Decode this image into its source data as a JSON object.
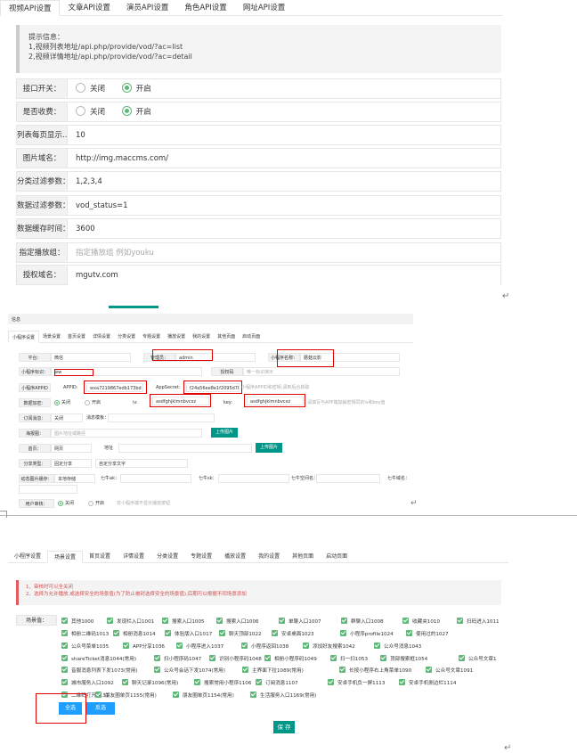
{
  "panel1": {
    "tabs": [
      {
        "label": "视频API设置",
        "active": true
      },
      {
        "label": "文章API设置"
      },
      {
        "label": "演员API设置"
      },
      {
        "label": "角色API设置"
      },
      {
        "label": "网址API设置"
      }
    ],
    "tip": {
      "title": "提示信息：",
      "line1": "1,视频列表地址/api.php/provide/vod/?ac=list",
      "line2": "2,视频详情地址/api.php/provide/vod/?ac=detail"
    },
    "api_switch": {
      "label": "接口开关：",
      "off": "关闭",
      "on": "开启"
    },
    "charge": {
      "label": "是否收费：",
      "off": "关闭",
      "on": "开启"
    },
    "page_size": {
      "label": "列表每页显示...",
      "value": "10"
    },
    "pic_domain": {
      "label": "图片域名：",
      "value": "http://img.maccms.com/"
    },
    "type_filter": {
      "label": "分类过滤参数：",
      "value": "1,2,3,4"
    },
    "data_filter": {
      "label": "数据过滤参数：",
      "value": "vod_status=1"
    },
    "cache_time": {
      "label": "数据缓存时间：",
      "value": "3600"
    },
    "play_group": {
      "label": "指定播放组：",
      "placeholder": "指定播放组 例如youku"
    },
    "auth_domain": {
      "label": "授权域名：",
      "value": "mgutv.com"
    },
    "return_mark": "↵"
  },
  "panel2": {
    "title": "信息",
    "tabs": [
      "小程序设置",
      "场景设置",
      "首页设置",
      "详情设置",
      "分类设置",
      "专题设置",
      "播放设置",
      "我的设置",
      "其他页面",
      "启动页面"
    ],
    "platform": {
      "label": "平台：",
      "value": "微信"
    },
    "admin": {
      "label": "管理员：",
      "value": "admin"
    },
    "mp_name": {
      "label": "小程序名称：",
      "value": "蘑菇云影"
    },
    "mp_id": {
      "label": "小程序标识：",
      "value": "ww"
    },
    "auth_code": {
      "label": "授权码",
      "placeholder": "唯一标识演示"
    },
    "mp_appid": {
      "label": "小程序APPID",
      "appid_label": "APPID:",
      "appid": "wxa7219867edb173bd",
      "secret_label": "AppSecret:",
      "secret": "f24a56ee8e1f2095d7b459f",
      "hint": "小程序APPID和密钥,请到后台获取"
    },
    "data_encrypt": {
      "label": "数据加密：",
      "off": "关闭",
      "on": "开启",
      "iv_label": "iv:",
      "iv": "asdfghjklmnbvcxz",
      "key_label": "key:",
      "key": "asdfghjklmnbvcxz",
      "hint": "请填写与APP端加解密相同的iv和key值"
    },
    "sub_msg": {
      "label": "订阅消息：",
      "value": "关闭",
      "tpl_label": "消息模板："
    },
    "share_img": {
      "label": "海报图：",
      "placeholder": "图片地址或路径",
      "upload": "上传图片"
    },
    "home": {
      "label": "首页：",
      "value": "网页",
      "addr_label": "地址"
    },
    "upload2": "上传图片",
    "share_type": {
      "label": "分享类型：",
      "value": "固定分享",
      "text": "自定分享文字"
    },
    "dyn_img": {
      "label": "动态图片缓存：",
      "value": "本地存储",
      "seven_ak": "七牛ak：",
      "seven_sk": "七牛sk：",
      "seven_space": "七牛空间名：",
      "seven_domain": "七牛域名："
    },
    "user_review": {
      "label": "用户审核：",
      "off": "关闭",
      "on": "开启",
      "hint": "非小程序端不显示播放按钮"
    },
    "return_mark": "↵"
  },
  "panel3": {
    "tabs": [
      {
        "label": "小程序设置"
      },
      {
        "label": "场景设置",
        "active": true
      },
      {
        "label": "首页设置"
      },
      {
        "label": "详情设置"
      },
      {
        "label": "分类设置"
      },
      {
        "label": "专题设置"
      },
      {
        "label": "播放设置"
      },
      {
        "label": "我的设置"
      },
      {
        "label": "其他页面"
      },
      {
        "label": "启动页面"
      }
    ],
    "tip": {
      "line1": "1、审核时可以全关闭",
      "line2": "2、选择为允许播放,或选择安全的场景值(为了防止被封选择安全的场景值),后期可以根据不同场景添加"
    },
    "scene_label": "场景值：",
    "scenes": [
      [
        "其他1000",
        "发现栏入口1001",
        "搜索入口1005",
        "搜索入口1006",
        "单聊入口1007",
        "群聊入口1008",
        "收藏夹1010",
        "扫码进入1011"
      ],
      [
        "相册二维码1013",
        "相册消息1014",
        "体验版入口1017",
        "聊天顶部1022",
        "安卓桌面1023",
        "小程序profile1024",
        "使用过的1027"
      ],
      [
        "公众号菜单1035",
        "APP分享1036",
        "小程序进入1037",
        "小程序返回1038",
        "添加好友搜索1042",
        "公众号消息1043"
      ],
      [
        "shareTicket消息1044(常用)",
        "扫小程序码1047",
        "识别小程序码1048",
        "相册小程序码1049",
        "扫一扫1053",
        "顶部搜索框1054",
        "公众号文章1"
      ],
      [
        "音服消息列表下发1073(常用)",
        "公众号会话下发1074(常用)",
        "主界面下拉1089(常用)",
        "长按小程序右上角菜单1090",
        "公众号文章1091"
      ],
      [
        "城市服务入口1092",
        "聊天记录1096(常用)",
        "搜索常用小程序1106",
        "订阅消息1107",
        "安卓手机负一屏1113",
        "安卓手机侧边栏1114"
      ],
      [
        "二维码打开1131",
        "朋友圈单页1155(常用)",
        "朋友圈单页1154(常用)",
        "生活服务入口1169(常用)"
      ]
    ],
    "select_all": "全选",
    "invert": "反选",
    "save": "保 存",
    "return_mark": "↵"
  }
}
